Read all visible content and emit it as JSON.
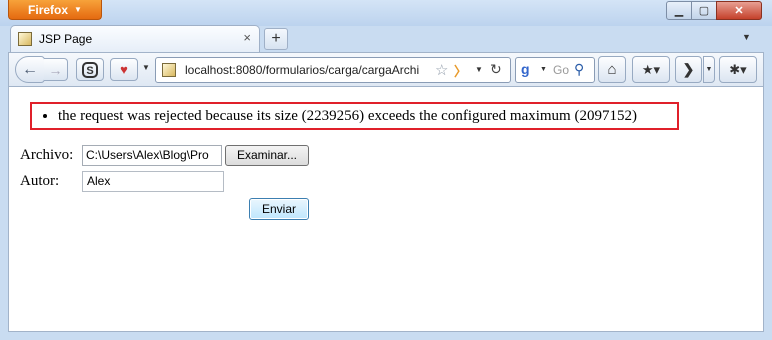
{
  "browser": {
    "menu_button_label": "Firefox",
    "tab_title": "JSP Page",
    "url": "localhost:8080/formularios/carga/cargaArchi",
    "search_engine_placeholder": "Go",
    "new_tab_label": "+"
  },
  "icons": {
    "back": "back-arrow",
    "forward": "forward-arrow",
    "home": "home",
    "bookmark": "bookmark-star",
    "reload": "reload",
    "star": "star",
    "search": "magnifier"
  },
  "page": {
    "errors": [
      "the request was rejected because its size (2239256) exceeds the configured maximum (2097152)"
    ],
    "form": {
      "archivo_label": "Archivo:",
      "archivo_value": "C:\\Users\\Alex\\Blog\\Pro",
      "browse_label": "Examinar...",
      "autor_label": "Autor:",
      "autor_value": "Alex",
      "submit_label": "Enviar"
    }
  },
  "colors": {
    "error_border": "#e0202a",
    "firefox_button": "#e56a10"
  }
}
